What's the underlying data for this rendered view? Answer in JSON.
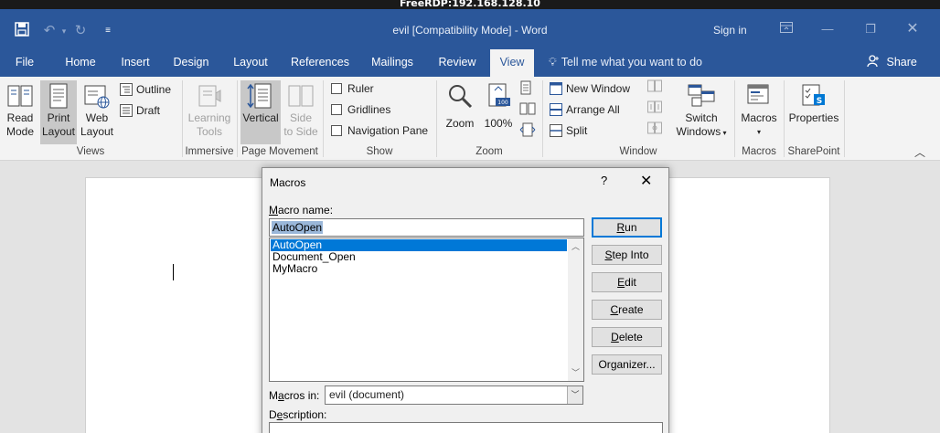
{
  "rdp": {
    "title": "FreeRDP:192.168.128.10"
  },
  "titlebar": {
    "doc_title": "evil [Compatibility Mode]  -  Word",
    "sign_in": "Sign in"
  },
  "tabs": [
    {
      "label": "File"
    },
    {
      "label": "Home"
    },
    {
      "label": "Insert"
    },
    {
      "label": "Design"
    },
    {
      "label": "Layout"
    },
    {
      "label": "References"
    },
    {
      "label": "Mailings"
    },
    {
      "label": "Review"
    },
    {
      "label": "View",
      "active": true
    }
  ],
  "tellme": "Tell me what you want to do",
  "share": "Share",
  "ribbon": {
    "views": {
      "label": "Views",
      "read_mode": [
        "Read",
        "Mode"
      ],
      "print_layout": [
        "Print",
        "Layout"
      ],
      "web_layout": [
        "Web",
        "Layout"
      ],
      "outline": "Outline",
      "draft": "Draft"
    },
    "immersive": {
      "label": "Immersive",
      "learning_tools": [
        "Learning",
        "Tools"
      ]
    },
    "page_movement": {
      "label": "Page Movement",
      "vertical": "Vertical",
      "side_to_side": [
        "Side",
        "to Side"
      ]
    },
    "show": {
      "label": "Show",
      "ruler": "Ruler",
      "gridlines": "Gridlines",
      "navigation_pane": "Navigation Pane"
    },
    "zoom": {
      "label": "Zoom",
      "zoom": "Zoom",
      "hundred": "100%"
    },
    "window": {
      "label": "Window",
      "new_window": "New Window",
      "arrange_all": "Arrange All",
      "split": "Split",
      "switch_windows": [
        "Switch",
        "Windows"
      ]
    },
    "macros": {
      "label": "Macros",
      "macros": "Macros"
    },
    "sharepoint": {
      "label": "SharePoint",
      "properties": "Properties"
    }
  },
  "dialog": {
    "title": "Macros",
    "help": "?",
    "close": "✕",
    "macro_name_label": {
      "pre": "",
      "key": "M",
      "post": "acro name:"
    },
    "macro_name_value": "AutoOpen",
    "macro_list": [
      "AutoOpen",
      "Document_Open",
      "MyMacro"
    ],
    "selected_index": 0,
    "buttons": {
      "run": {
        "pre": "",
        "key": "R",
        "post": "un"
      },
      "step_into": {
        "pre": "",
        "key": "S",
        "post": "tep Into"
      },
      "edit": {
        "pre": "",
        "key": "E",
        "post": "dit"
      },
      "create": {
        "pre": "",
        "key": "C",
        "post": "reate"
      },
      "delete": {
        "pre": "",
        "key": "D",
        "post": "elete"
      },
      "organizer": {
        "pre": "Or",
        "key": "g",
        "post": "anizer..."
      }
    },
    "macros_in_label": {
      "pre": "M",
      "key": "a",
      "post": "cros in:"
    },
    "macros_in_value": "evil (document)",
    "description_label": {
      "pre": "D",
      "key": "e",
      "post": "scription:"
    }
  }
}
